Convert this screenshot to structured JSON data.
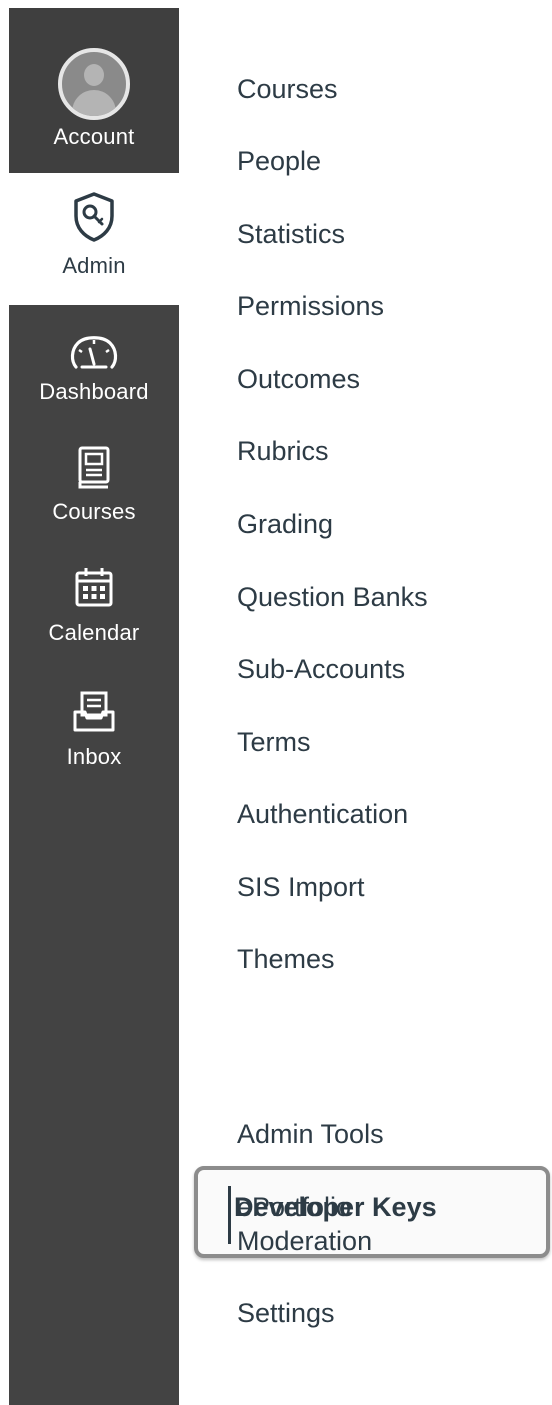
{
  "global_nav": {
    "account_label": "Account",
    "admin_label": "Admin",
    "dashboard_label": "Dashboard",
    "courses_label": "Courses",
    "calendar_label": "Calendar",
    "inbox_label": "Inbox",
    "colors": {
      "rail": "#434343",
      "text": "#ffffff"
    }
  },
  "admin_nav": {
    "items": [
      "Courses",
      "People",
      "Statistics",
      "Permissions",
      "Outcomes",
      "Rubrics",
      "Grading",
      "Question Banks",
      "Sub-Accounts",
      "Terms",
      "Authentication",
      "SIS Import",
      "Themes",
      "Developer Keys",
      "Admin Tools",
      "ePortfolio Moderation",
      "Settings"
    ],
    "active_item": "Developer Keys",
    "text_color": "#2d3b45"
  }
}
